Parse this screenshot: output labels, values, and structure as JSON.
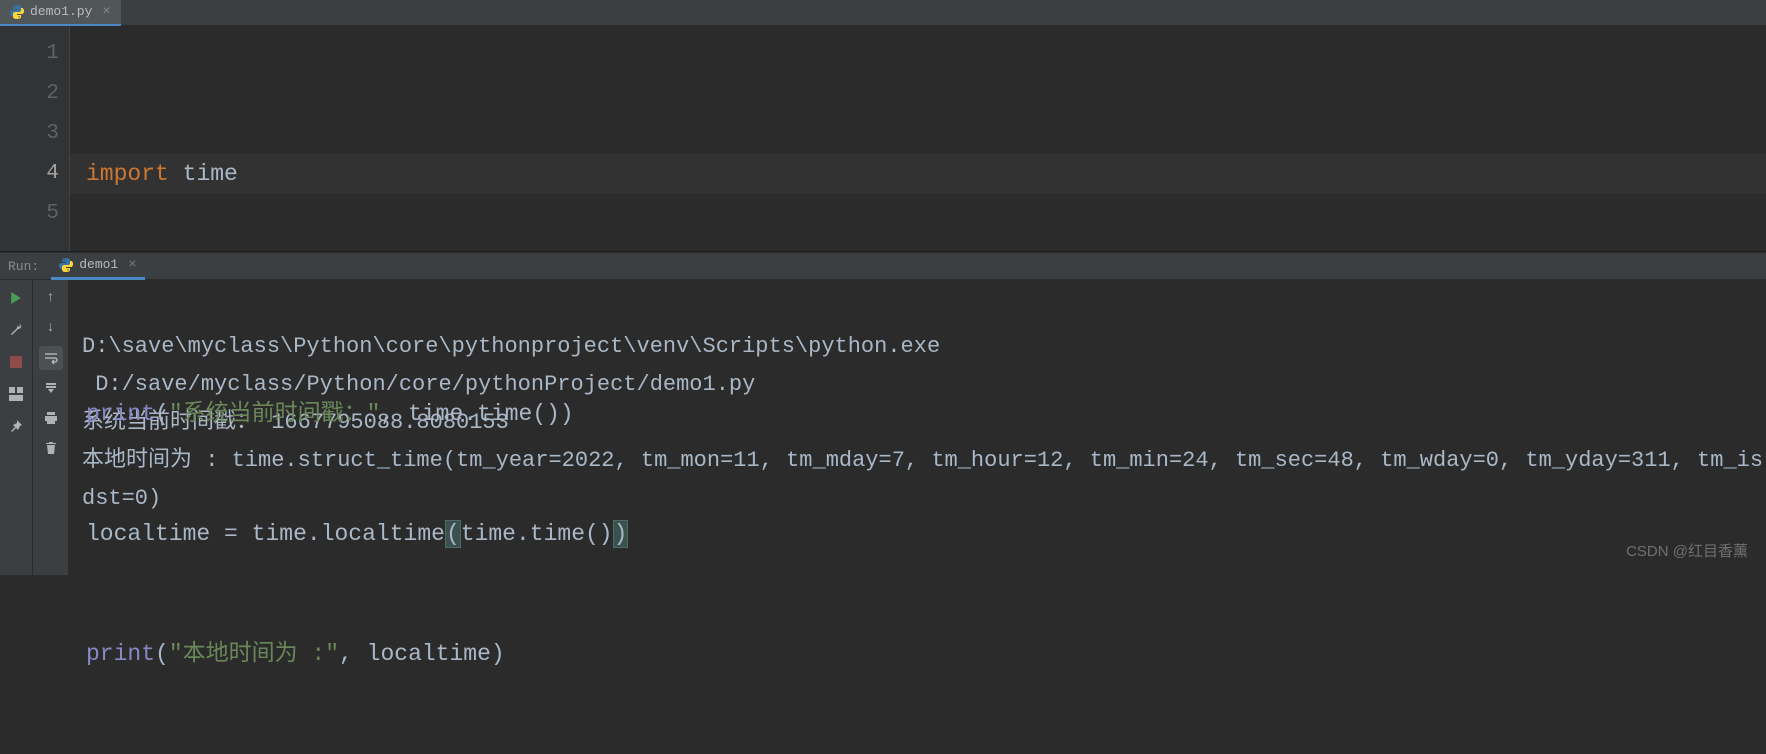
{
  "tab": {
    "filename": "demo1.py"
  },
  "editor": {
    "line_numbers": [
      "1",
      "2",
      "3",
      "4",
      "5"
    ],
    "current_line_index": 3,
    "code": {
      "l1": {
        "kw": "import",
        "mod": "time"
      },
      "l3": {
        "fn": "print",
        "str": "\"系统当前时间戳：\"",
        "comma": ",",
        "obj": "time",
        "dot": ".",
        "call": "time",
        "p1": "(",
        "p2": "()",
        "p3": ")"
      },
      "l4": {
        "var": "localtime",
        "eq": "=",
        "obj1": "time",
        "dot1": ".",
        "call1": "localtime",
        "po": "(",
        "obj2": "time",
        "dot2": ".",
        "call2": "time",
        "pp": "()",
        "pc": ")"
      },
      "l5": {
        "fn": "print",
        "str": "\"本地时间为 :\"",
        "comma": ",",
        "var": "localtime",
        "p1": "(",
        "p2": ")"
      }
    }
  },
  "run": {
    "label": "Run:",
    "tab_name": "demo1",
    "output": {
      "line1": "D:\\save\\myclass\\Python\\core\\pythonproject\\venv\\Scripts\\python.exe ",
      "line2": " D:/save/myclass/Python/core/pythonProject/demo1.py",
      "line3": "系统当前时间戳： 1667795088.8080153",
      "line4": "本地时间为 : time.struct_time(tm_year=2022, tm_mon=11, tm_mday=7, tm_hour=12, tm_min=24, tm_sec=48, tm_wday=0, tm_yday=311, tm_isdst=0)"
    }
  },
  "watermark": "CSDN @红目香薰"
}
